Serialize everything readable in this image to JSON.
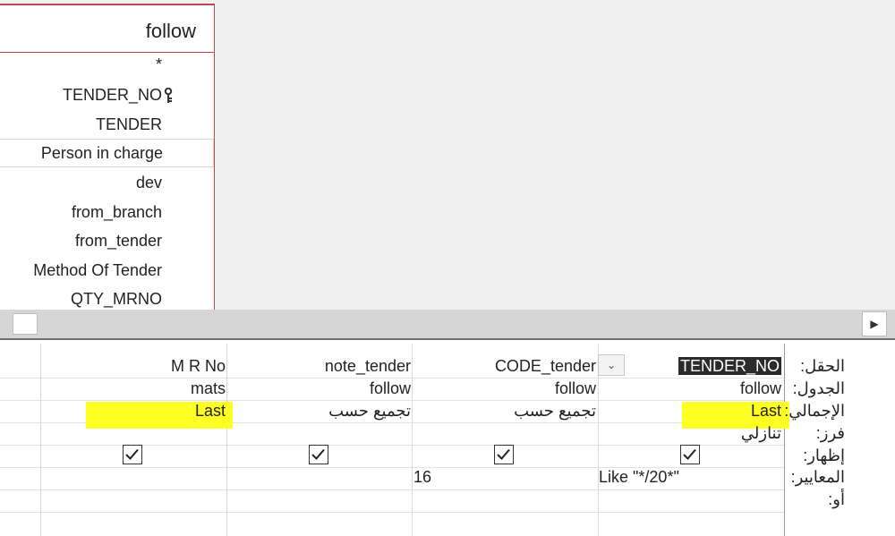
{
  "table": {
    "title": "follow",
    "fields": [
      "*",
      "TENDER_NO",
      "TENDER",
      "Person in charge",
      "dev",
      "from_branch",
      "from_tender",
      "Method Of Tender",
      "QTY_MRNO"
    ]
  },
  "row_labels": {
    "field": "الحقل:",
    "table": "الجدول:",
    "total": "الإجمالي:",
    "sort": "فرز:",
    "show": "إظهار:",
    "criteria": "المعايير:",
    "or": "أو:"
  },
  "columns": [
    {
      "field": "TENDER_NO",
      "table": "follow",
      "total": "Last",
      "sort": "تنازلي",
      "show": true,
      "criteria": "Like \"*/20*\""
    },
    {
      "field": "CODE_tender",
      "table": "follow",
      "total": "تجميع حسب",
      "sort": "",
      "show": true,
      "criteria": "16"
    },
    {
      "field": "note_tender",
      "table": "follow",
      "total": "تجميع حسب",
      "sort": "",
      "show": true,
      "criteria": ""
    },
    {
      "field": "M R No",
      "table": "mats",
      "total": "Last",
      "sort": "",
      "show": true,
      "criteria": ""
    }
  ],
  "colors": {
    "highlight": "#ffff24",
    "table_border": "#b94a50",
    "selected_field_bg": "#2b2b2b"
  },
  "icons": {
    "primary_key": "key-icon",
    "dropdown": "chevron-down-icon",
    "scroll_right": "triangle-right-icon"
  }
}
